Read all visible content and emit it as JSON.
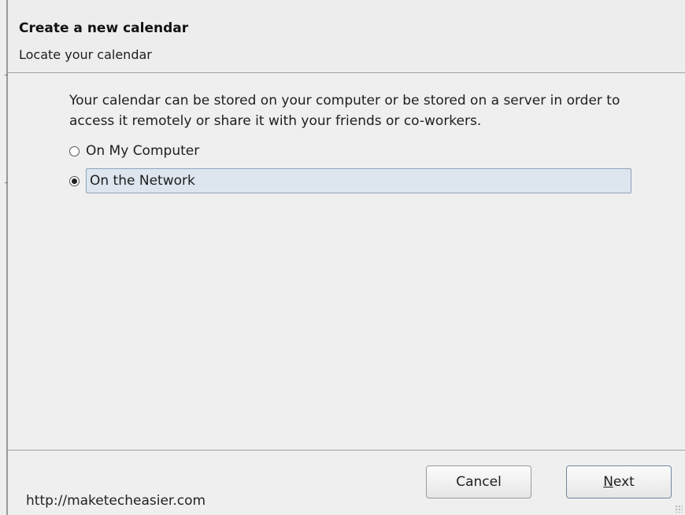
{
  "dialog": {
    "title": "Create a new calendar",
    "subtitle": "Locate your calendar",
    "description": "Your calendar can be stored on your computer or be stored on a server in order to access it remotely or share it with your friends or co-workers.",
    "options": [
      {
        "label": "On My Computer",
        "selected": false
      },
      {
        "label": "On the Network",
        "selected": true
      }
    ],
    "buttons": {
      "cancel_label": "Cancel",
      "next_mnemonic": "N",
      "next_rest": "ext"
    }
  },
  "watermark": "http://maketecheasier.com",
  "colors": {
    "background": "#efefef",
    "selection_fill": "#dde5ee",
    "selection_border": "#8fa3bb",
    "separator": "#a3a3a3"
  },
  "icons": {
    "radio_unchecked": "radio-unchecked-icon",
    "radio_checked": "radio-checked-icon",
    "resize_grip": "resize-grip-icon"
  }
}
